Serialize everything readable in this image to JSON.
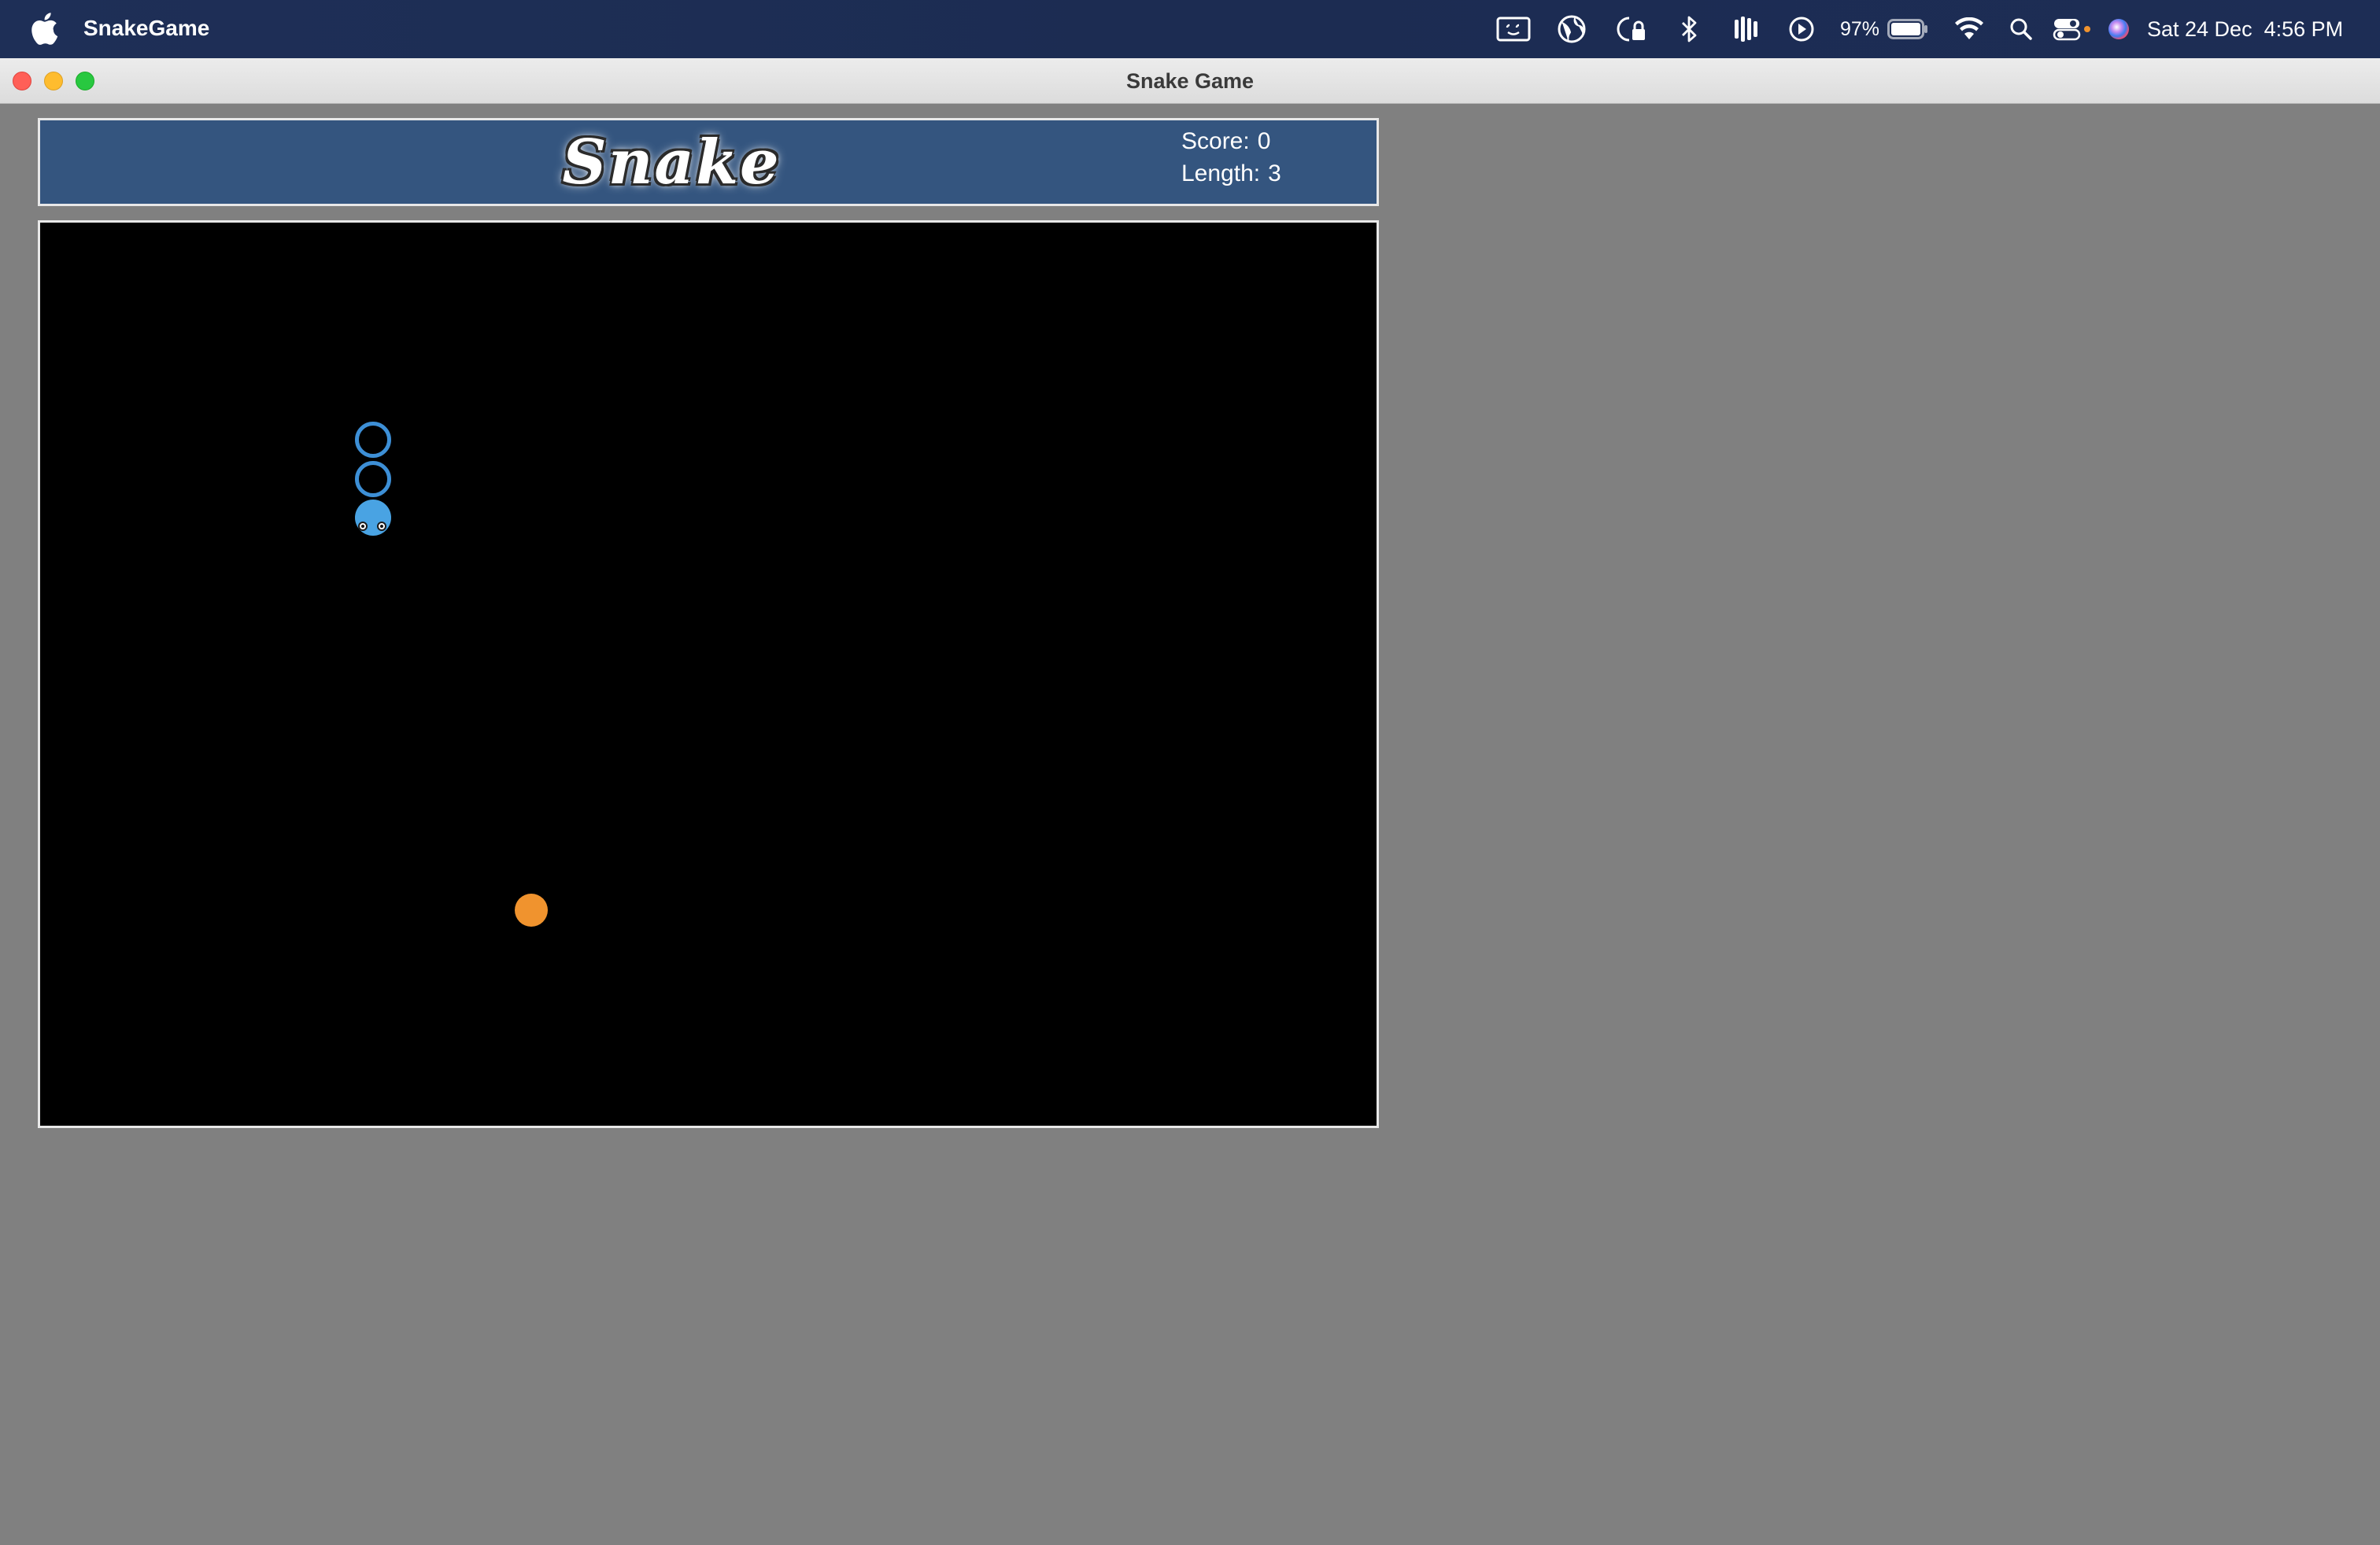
{
  "menubar": {
    "app_name": "SnakeGame",
    "battery_percent": "97%",
    "clock": "Sat 24 Dec  4:56 PM",
    "icons": [
      "apple-icon",
      "screen-share-icon",
      "globe-icon",
      "lock-icon",
      "bluetooth-icon",
      "audio-icon",
      "play-icon",
      "battery-icon",
      "wifi-icon",
      "spotlight-icon",
      "control-center-icon",
      "siri-icon"
    ]
  },
  "window": {
    "title": "Snake Game"
  },
  "game": {
    "logo": "Snake",
    "score_label": "Score:",
    "score_value": "0",
    "length_label": "Length:",
    "length_value": "3",
    "colors": {
      "header_bg": "#34557f",
      "board_bg": "#000000",
      "snake": "#49a3e3",
      "food": "#f0932e"
    }
  }
}
